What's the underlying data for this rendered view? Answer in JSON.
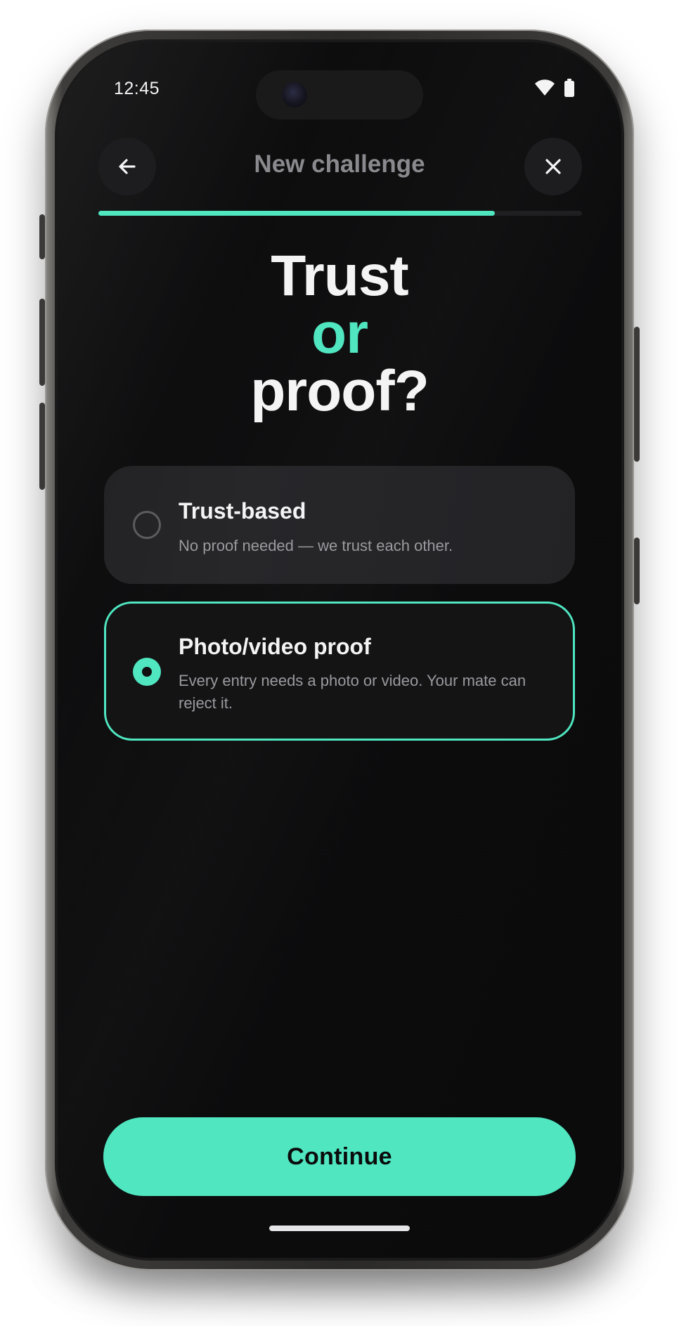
{
  "status_bar": {
    "time": "12:45",
    "icons": [
      "wifi-icon",
      "battery-icon"
    ]
  },
  "header": {
    "title": "New challenge",
    "back_icon": "arrow-left-icon",
    "close_icon": "close-icon"
  },
  "progress": {
    "fraction": 0.82
  },
  "question": {
    "line1": "Trust",
    "line2": "or",
    "line3": "proof?"
  },
  "options": [
    {
      "title": "Trust-based",
      "description": "No proof needed — we trust each other.",
      "selected": false
    },
    {
      "title": "Photo/video proof",
      "description": "Every entry needs a photo or video. Your mate can reject it.",
      "selected": true
    }
  ],
  "primary_action": {
    "label": "Continue"
  },
  "colors": {
    "accent": "#4fe6c0",
    "background": "#0b0b0c",
    "card": "#242427",
    "text_primary": "#f4f4f5",
    "text_secondary": "#9a9a9f"
  }
}
